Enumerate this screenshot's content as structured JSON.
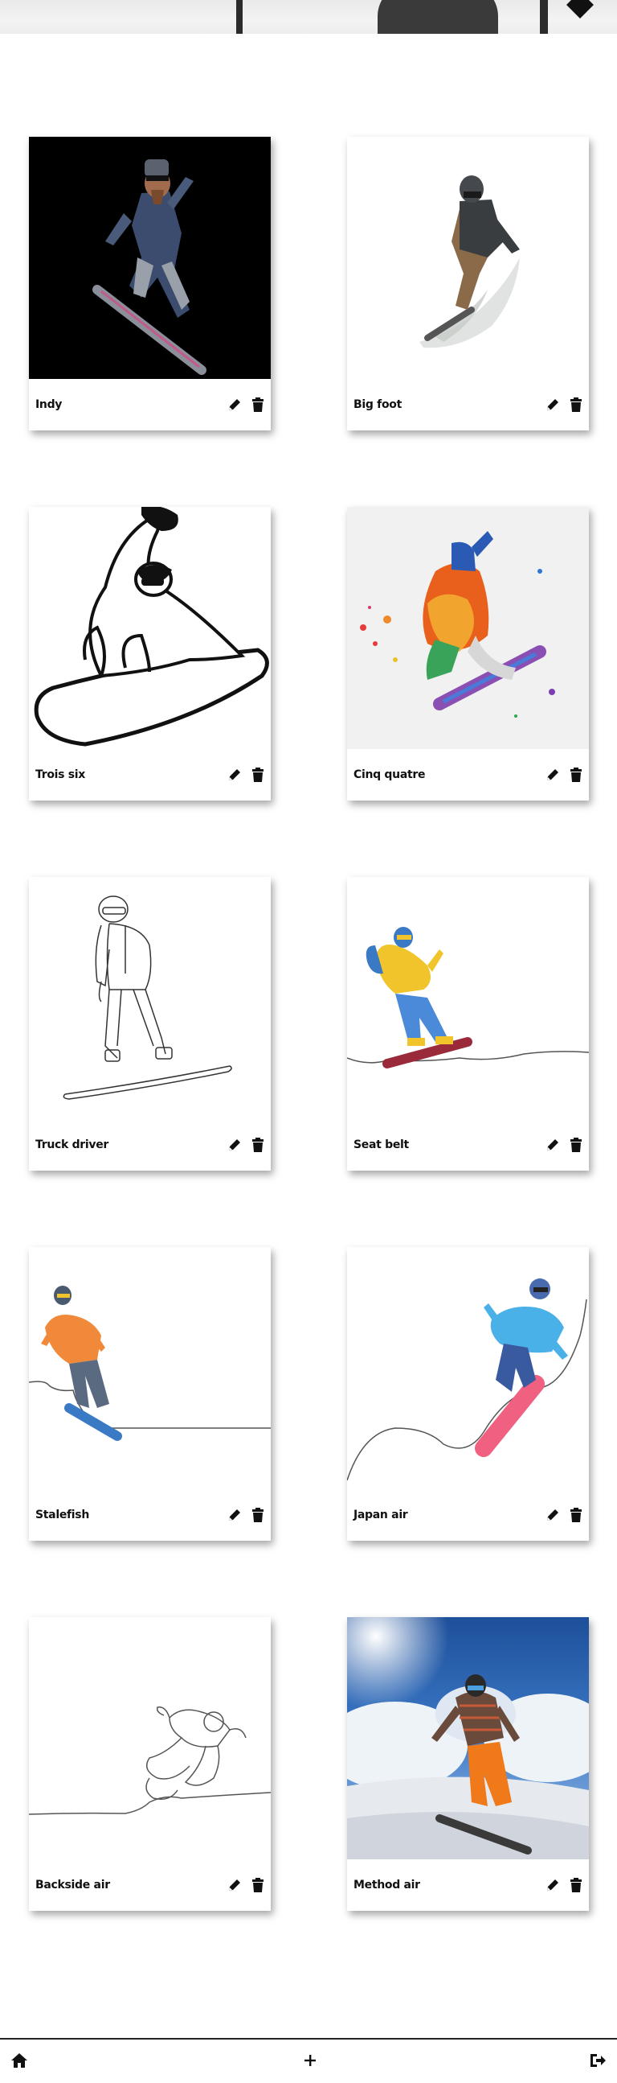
{
  "header": {
    "image_icon": "snowboarder-banner"
  },
  "cards": [
    {
      "name": "Indy",
      "art_icon": "snowboarder-photo-black-bg-icon"
    },
    {
      "name": "Big foot",
      "art_icon": "snowboarder-watercolor-gray-icon"
    },
    {
      "name": "Trois six",
      "art_icon": "snowboarder-outline-bold-icon"
    },
    {
      "name": "Cinq quatre",
      "art_icon": "snowboarder-rainbow-splash-icon"
    },
    {
      "name": "Truck driver",
      "art_icon": "snowboarder-line-drawing-icon"
    },
    {
      "name": "Seat belt",
      "art_icon": "snowboarder-yellow-blue-line-icon"
    },
    {
      "name": "Stalefish",
      "art_icon": "snowboarder-orange-line-icon"
    },
    {
      "name": "Japan air",
      "art_icon": "snowboarder-blue-pink-line-icon"
    },
    {
      "name": "Backside air",
      "art_icon": "snowboarder-gray-line-icon"
    },
    {
      "name": "Method air",
      "art_icon": "snowboarder-sky-photo-icon"
    }
  ],
  "actions": {
    "edit_icon": "pencil-icon",
    "delete_icon": "trash-icon"
  },
  "bottom_nav": {
    "home_icon": "home-icon",
    "add_icon": "plus-icon",
    "logout_icon": "logout-icon"
  },
  "colors": {
    "text": "#111111",
    "background": "#ffffff",
    "shadow": "rgba(0,0,0,0.35)"
  }
}
